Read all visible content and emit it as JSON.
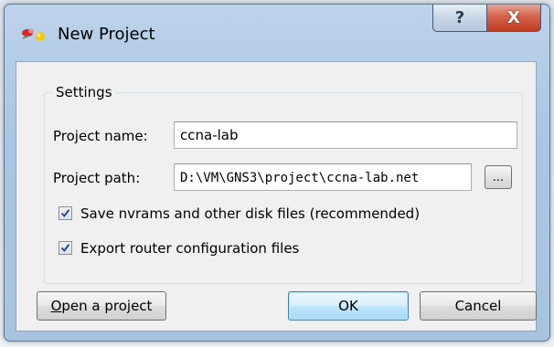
{
  "window": {
    "title": "New Project",
    "help_glyph": "?",
    "close_glyph": "X",
    "icon": "gns3-app-icon"
  },
  "settings": {
    "group_title": "Settings",
    "project_name_label": "Project name:",
    "project_name_value": "ccna-lab",
    "project_path_label": "Project path:",
    "project_path_value": "D:\\VM\\GNS3\\project\\ccna-lab.net",
    "browse_label": "...",
    "save_nvrams_label": "Save nvrams and other disk files (recommended)",
    "save_nvrams_checked": true,
    "export_config_label": "Export router configuration files",
    "export_config_checked": true
  },
  "footer": {
    "open_project_label": "Open a project",
    "ok_label": "OK",
    "cancel_label": "Cancel"
  },
  "colors": {
    "accent": "#3c7fb1",
    "close_red": "#c23a1f",
    "check_blue": "#2b4a8c"
  }
}
